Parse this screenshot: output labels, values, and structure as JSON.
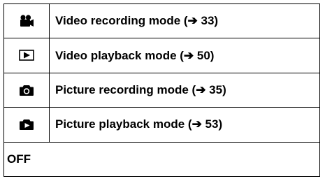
{
  "modes": [
    {
      "icon": "video-camera-icon",
      "label": "Video recording mode (➔ 33)"
    },
    {
      "icon": "play-box-icon",
      "label": "Video playback mode (➔ 50)"
    },
    {
      "icon": "camera-icon",
      "label": "Picture recording mode (➔ 35)"
    },
    {
      "icon": "picture-playback-icon",
      "label": "Picture playback mode (➔ 53)"
    }
  ],
  "off_label": "OFF"
}
